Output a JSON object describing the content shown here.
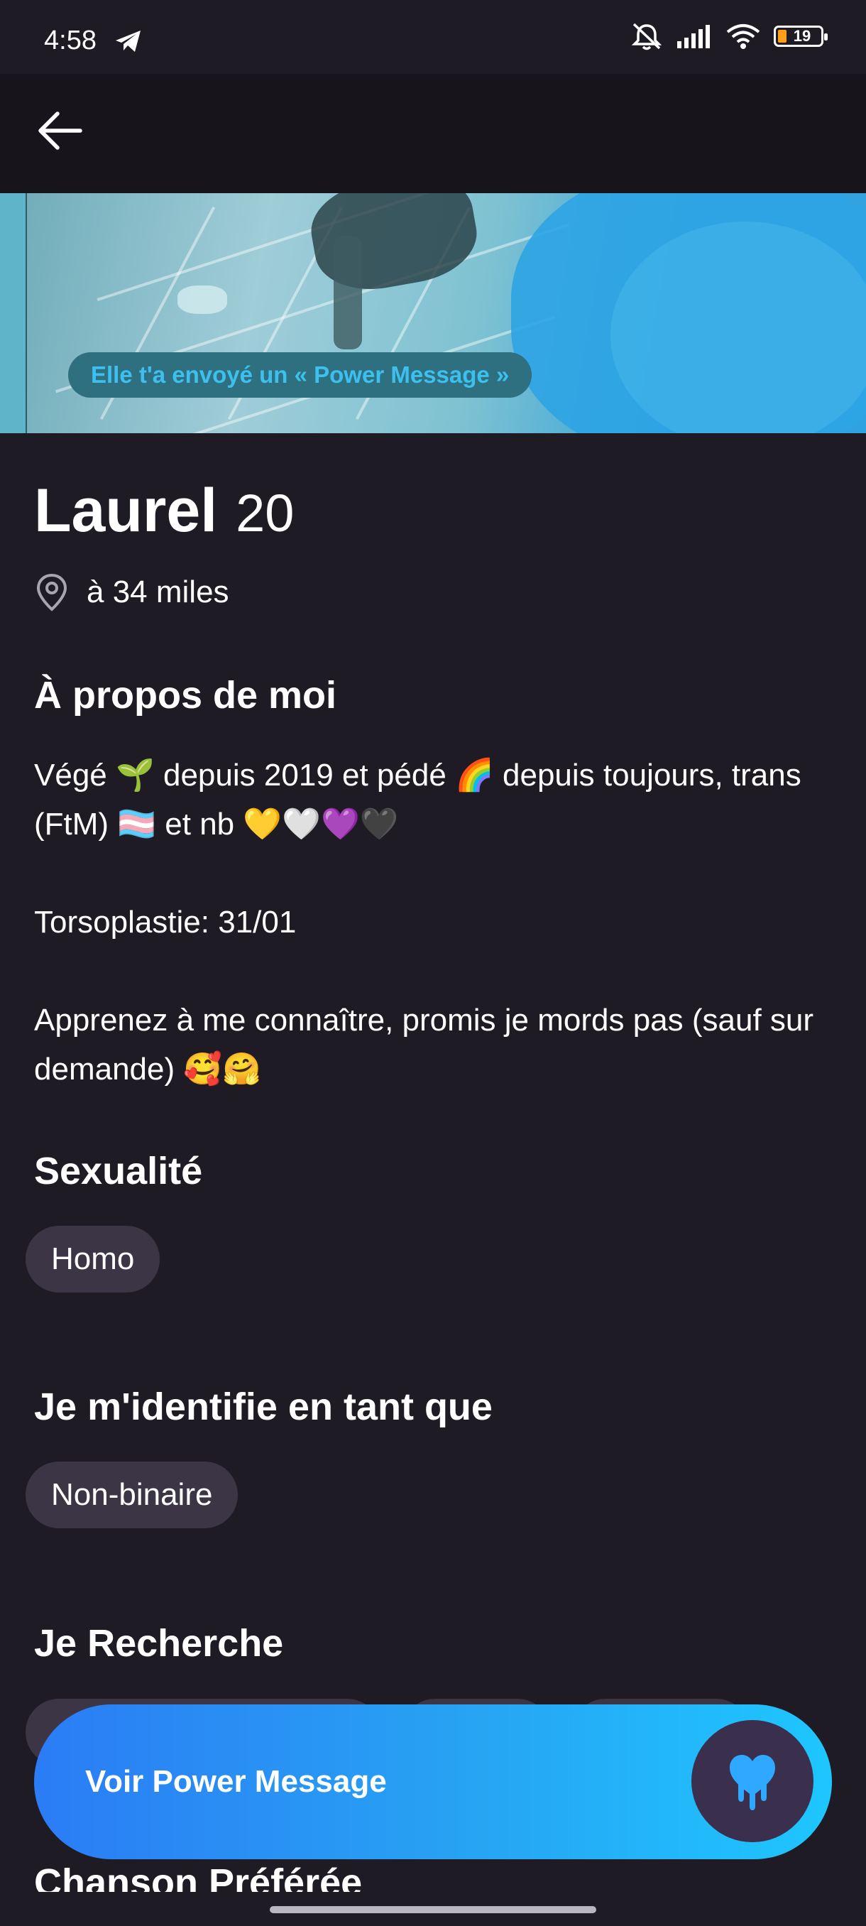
{
  "status_bar": {
    "time": "4:58",
    "battery": "19",
    "icons": [
      "telegram-icon",
      "mute-icon",
      "signal-icon",
      "wifi-icon",
      "battery-icon"
    ]
  },
  "header": {
    "back_icon": "arrow-left-icon"
  },
  "photo": {
    "banner": "Elle t'a envoyé un « Power Message »"
  },
  "profile": {
    "name": "Laurel",
    "age": "20",
    "distance": "à 34 miles"
  },
  "about": {
    "title": "À propos de moi",
    "text": "Végé 🌱 depuis 2019 et pédé 🌈 depuis toujours, trans (FtM) 🏳️‍⚧️ et nb 💛🤍💜🖤\n\nTorsoplastie: 31/01\n\nApprenez à me connaître, promis je mords pas (sauf sur demande) 🥰🤗"
  },
  "sexuality": {
    "title": "Sexualité",
    "chips": [
      "Homo"
    ]
  },
  "identity": {
    "title": "Je m'identifie en tant que",
    "chips": [
      "Non-binaire"
    ]
  },
  "looking_for": {
    "title": "Je Recherche"
  },
  "favorite_song": {
    "title": "Chanson Préférée"
  },
  "cta": {
    "label": "Voir Power Message",
    "icon": "dripping-heart-icon"
  },
  "colors": {
    "background": "#1f1b24",
    "chip": "#3b3546",
    "accent": "#27a4f3",
    "banner_text": "#3ec0ee"
  }
}
